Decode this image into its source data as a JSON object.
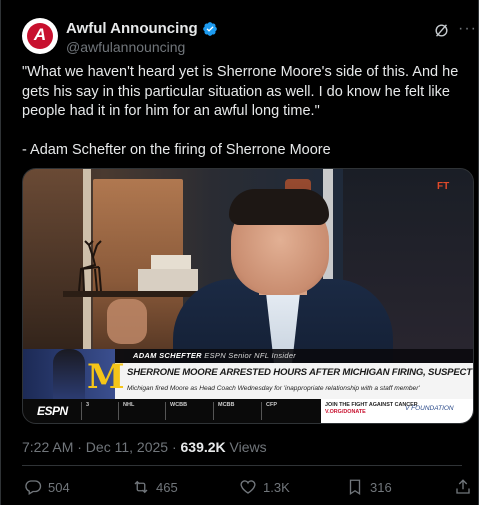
{
  "author": {
    "display_name": "Awful Announcing",
    "handle": "@awfulannouncing",
    "avatar_letter": "A",
    "verified": true
  },
  "icons": {
    "verified": "verified-badge-icon",
    "grok": "grok-icon",
    "more": "more-icon",
    "reply": "reply-icon",
    "retweet": "retweet-icon",
    "like": "like-icon",
    "bookmark": "bookmark-icon",
    "share": "share-icon"
  },
  "tweet": {
    "text": "\"What we haven't heard yet is Sherrone Moore's side of this. And he gets his say in this particular situation as well. I do know he felt like people had it in for him for an awful long time.\"\n\n- Adam Schefter on the firing of Sherrone Moore"
  },
  "media": {
    "network_bug": "FT",
    "lower_third_name": "ADAM SCHEFTER",
    "lower_third_title": "ESPN Senior NFL Insider",
    "headline": "SHERRONE MOORE ARRESTED HOURS AFTER MICHIGAN FIRING, SUSPECT IN ALLEGED ASSAULT",
    "subline": "Michigan fired Moore as Head Coach Wednesday for 'inappropriate relationship with a staff member'",
    "team_letter": "M",
    "ticker_logo": "ESPN",
    "ticker_items": [
      "NHL",
      "WCBB",
      "MCBB",
      "CFP"
    ],
    "ticker_lead": "3",
    "ad_line1": "JOIN THE FIGHT AGAINST CANCER",
    "ad_line2": "V.ORG/DONATE",
    "ad_logo": "V FOUNDATION"
  },
  "meta": {
    "time": "7:22 AM · Dec 11, 2025 · ",
    "views_count": "639.2K",
    "views_label": " Views"
  },
  "actions": {
    "replies": "504",
    "retweets": "465",
    "likes": "1.3K",
    "bookmarks": "316"
  },
  "colors": {
    "background": "#000000",
    "text_primary": "#e7e9ea",
    "text_secondary": "#71767b",
    "verified": "#1d9bf0",
    "brand_red": "#c8102e"
  }
}
